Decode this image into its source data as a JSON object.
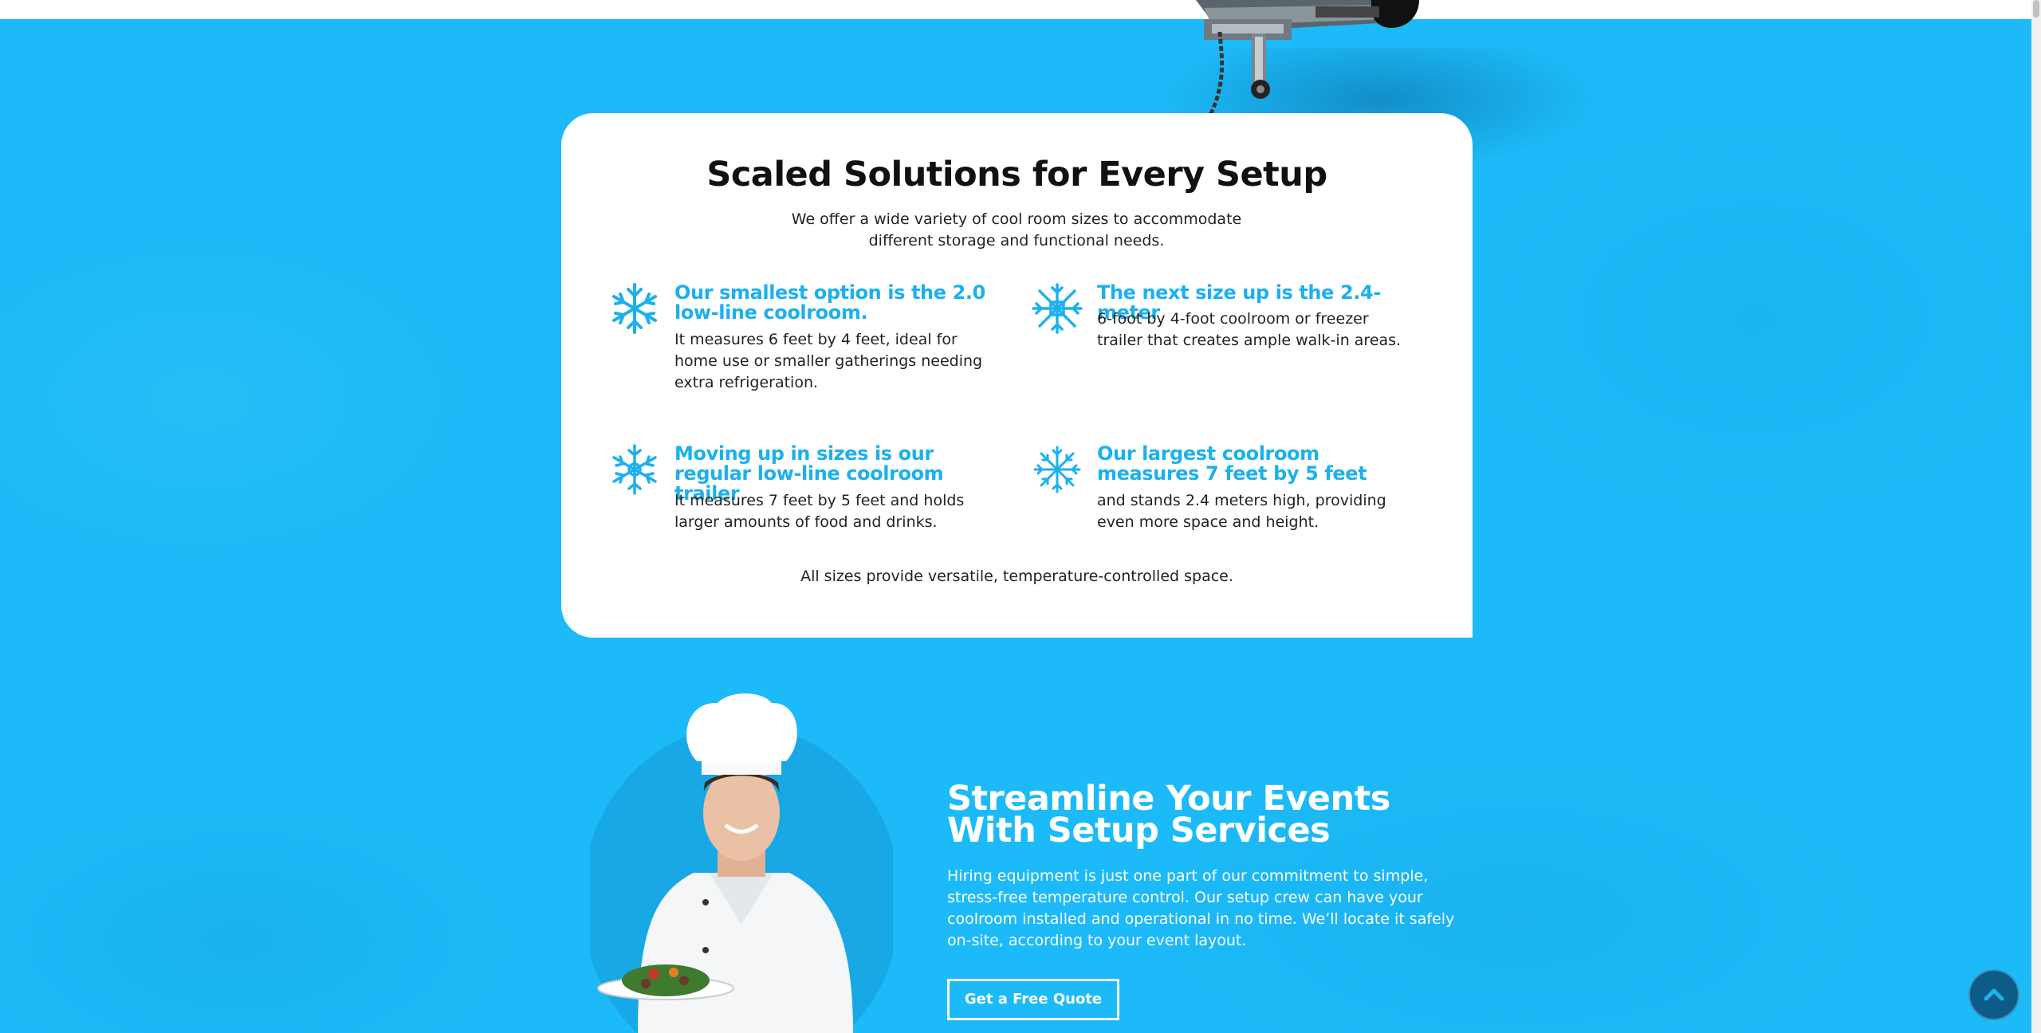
{
  "colors": {
    "background": "#1cbaf8",
    "accent": "#1cb0ee",
    "card": "#ffffff",
    "scroll_top": "#0d5b86"
  },
  "setup": {
    "title": "Scaled Solutions for Every Setup",
    "intro": "We offer a wide variety of cool room sizes to accommodate different storage and functional needs.",
    "features": [
      {
        "icon": "snowflake-icon",
        "title": "Our smallest option is the 2.0 low-line coolroom.",
        "text": "It measures 6 feet by 4 feet, ideal for home use or smaller gatherings needing extra refrigeration."
      },
      {
        "icon": "snowflake-icon",
        "title": "The next size up is the 2.4-meter",
        "text": "6-foot by 4-foot coolroom or freezer trailer that creates ample walk-in areas."
      },
      {
        "icon": "snowflake-icon",
        "title": "Moving up in sizes is our regular low-line coolroom trailer",
        "text": "It measures 7 feet by 5 feet and holds larger amounts of food and drinks."
      },
      {
        "icon": "snowflake-icon",
        "title": "Our largest coolroom measures 7 feet by 5 feet",
        "text": "and stands 2.4 meters high, providing even more space and height."
      }
    ],
    "footer": "All sizes provide versatile, temperature-controlled space."
  },
  "streamline": {
    "title_line1": "Streamline Your Events",
    "title_line2": "With Setup Services",
    "body": "Hiring equipment is just one part of our commitment to simple, stress-free temperature control. Our setup crew can have your coolroom installed and operational in no time. We’ll locate it safely on-site, according to your event layout.",
    "cta": "Get a Free Quote"
  },
  "scroll_top_icon": "chevron-up-icon"
}
